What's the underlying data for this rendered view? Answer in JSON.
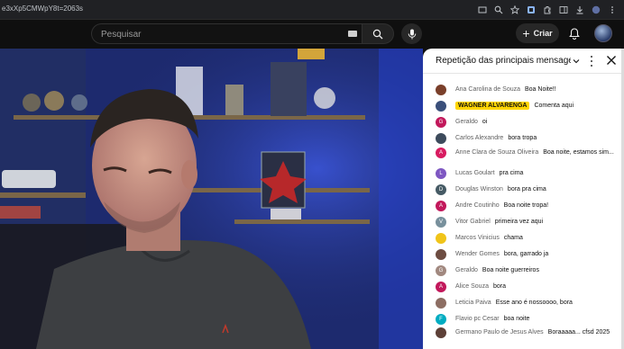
{
  "browser": {
    "url": "e3xXp5CMWpY8t=2063s",
    "icons": [
      "cast-icon",
      "zoom-icon",
      "bookmark-star-icon",
      "extension-icon",
      "puzzle-icon",
      "sidepanel-icon",
      "download-icon",
      "profile-icon",
      "menu-icon"
    ]
  },
  "topbar": {
    "search_placeholder": "Pesquisar",
    "create_label": "Criar"
  },
  "chat": {
    "title": "Repetição das principais mensagen...",
    "messages": [
      {
        "author": "Ana Carolina de Souza",
        "text": "Boa Noite!!",
        "initial": "",
        "color": "#7a3f2a",
        "owner": false
      },
      {
        "author": "WAGNER ALVARENGA",
        "text": "Comenta aqui",
        "initial": "",
        "color": "#3a4f7a",
        "owner": true
      },
      {
        "author": "Geraldo",
        "text": "oi",
        "initial": "G",
        "color": "#c2185b",
        "owner": false
      },
      {
        "author": "Carlos Alexandre",
        "text": "bora tropa",
        "initial": "",
        "color": "#3d4b5c",
        "owner": false
      },
      {
        "author": "Anne Clara de Souza Oliveira",
        "text": "Boa noite, estamos sim...",
        "initial": "A",
        "color": "#d81b60",
        "owner": false
      },
      {
        "author": "Lucas Goulart",
        "text": "pra cima",
        "initial": "L",
        "color": "#7e57c2",
        "owner": false
      },
      {
        "author": "Douglas Winston",
        "text": "bora pra cima",
        "initial": "D",
        "color": "#455a64",
        "owner": false
      },
      {
        "author": "Andre Coutinho",
        "text": "Boa noite tropa!",
        "initial": "A",
        "color": "#c2185b",
        "owner": false
      },
      {
        "author": "Vitor Gabriel",
        "text": "primeira vez aqui",
        "initial": "V",
        "color": "#78909c",
        "owner": false
      },
      {
        "author": "Marcos Vinicius",
        "text": "chama",
        "initial": "",
        "color": "#f0c419",
        "owner": false
      },
      {
        "author": "Wender Gomes",
        "text": "bora, garrado ja",
        "initial": "",
        "color": "#6d4c41",
        "owner": false
      },
      {
        "author": "Geraldo",
        "text": "Boa noite guerreiros",
        "initial": "G",
        "color": "#a1887f",
        "owner": false
      },
      {
        "author": "Alice Souza",
        "text": "bora",
        "initial": "A",
        "color": "#c2185b",
        "owner": false
      },
      {
        "author": "Leticia Paiva",
        "text": "Esse ano é nossoooo, bora",
        "initial": "",
        "color": "#8d6e63",
        "owner": false
      },
      {
        "author": "Flavio pc Cesar",
        "text": "boa noite",
        "initial": "F",
        "color": "#00acc1",
        "owner": false
      },
      {
        "author": "Germano Paulo de Jesus Alves",
        "text": "Boraaaaa... cfsd 2025",
        "initial": "",
        "color": "#5d4037",
        "owner": false
      }
    ]
  }
}
